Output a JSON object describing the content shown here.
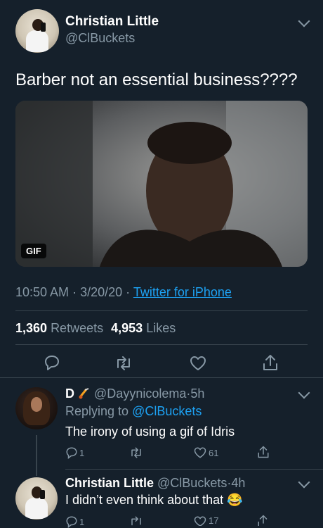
{
  "tweet": {
    "author_name": "Christian Little",
    "author_handle": "@ClBuckets",
    "text": "Barber not an essential business????",
    "media_badge": "GIF",
    "time": "10:50 AM",
    "date": "3/20/20",
    "separator": "·",
    "source": "Twitter for iPhone",
    "retweets_count": "1,360",
    "retweets_label": "Retweets",
    "likes_count": "4,953",
    "likes_label": "Likes"
  },
  "replies": [
    {
      "name": "D",
      "handle": "@Dayynicolema",
      "dot": "·",
      "time": "5h",
      "replying_prefix": "Replying to",
      "replying_handle": "@ClBuckets",
      "text": "The irony of using a gif of Idris",
      "reply_count": "1",
      "like_count": "61"
    },
    {
      "name": "Christian Little",
      "handle": "@ClBuckets",
      "dot": "·",
      "time": "4h",
      "text": "I didn’t even think about that",
      "emoji": "😂",
      "reply_count": "1",
      "like_count": "17"
    }
  ],
  "icons": [
    "chevron-down-icon",
    "reply-icon",
    "retweet-icon",
    "like-icon",
    "share-icon",
    "emoji-icon"
  ],
  "colors": {
    "background": "#15202b",
    "link": "#1da1f2",
    "muted": "#8899a6",
    "divider": "#38444d"
  }
}
